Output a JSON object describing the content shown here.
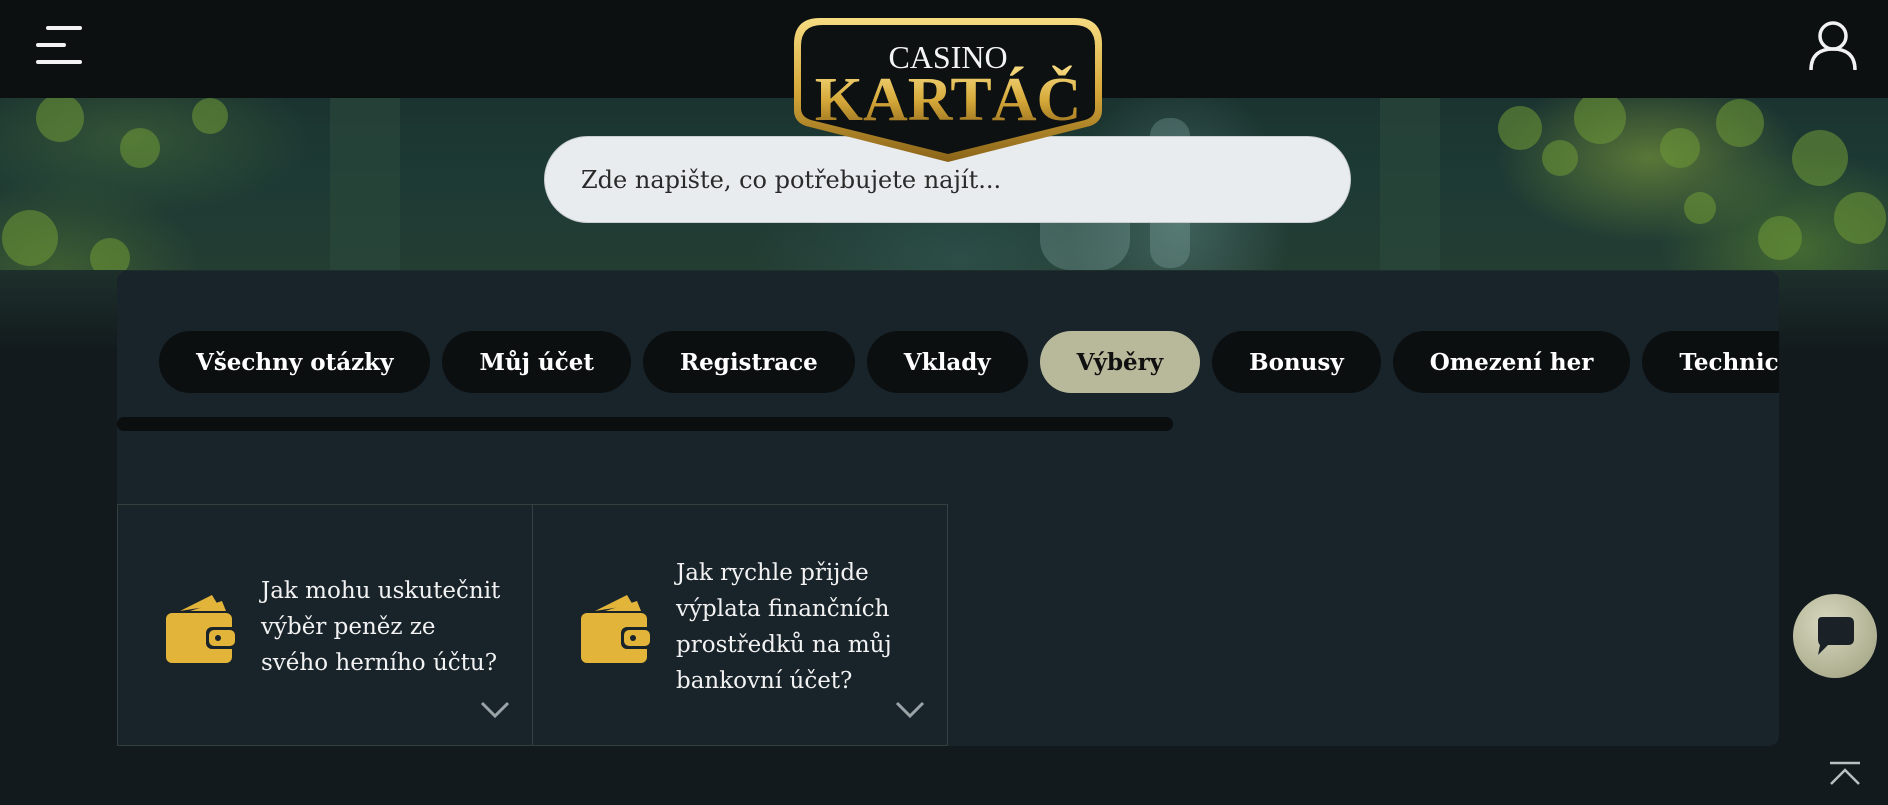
{
  "header": {
    "menu_icon": "hamburger-menu-icon",
    "user_icon": "user-icon",
    "logo": {
      "line1": "CASINO",
      "line2": "KARTÁČ"
    }
  },
  "search": {
    "placeholder": "Zde napište, co potřebujete najít..."
  },
  "tabs": [
    {
      "label": "Všechny otázky",
      "active": false
    },
    {
      "label": "Můj účet",
      "active": false
    },
    {
      "label": "Registrace",
      "active": false
    },
    {
      "label": "Vklady",
      "active": false
    },
    {
      "label": "Výběry",
      "active": true
    },
    {
      "label": "Bonusy",
      "active": false
    },
    {
      "label": "Omezení her",
      "active": false
    },
    {
      "label": "Technické problémy",
      "active": false
    }
  ],
  "faq": [
    {
      "question": "Jak mohu uskutečnit výběr peněz ze svého herního účtu?",
      "icon": "wallet-icon"
    },
    {
      "question": "Jak rychle přijde výplata finančních prostředků na můj bankovní účet?",
      "icon": "wallet-icon"
    }
  ],
  "colors": {
    "accent_gold": "#e2b43a",
    "active_tab": "#b8b99a",
    "panel": "#18232a",
    "topbar": "#0c1011"
  },
  "floating": {
    "chat_icon": "chat-bubble-icon",
    "scroll_top_icon": "scroll-to-top-icon"
  }
}
